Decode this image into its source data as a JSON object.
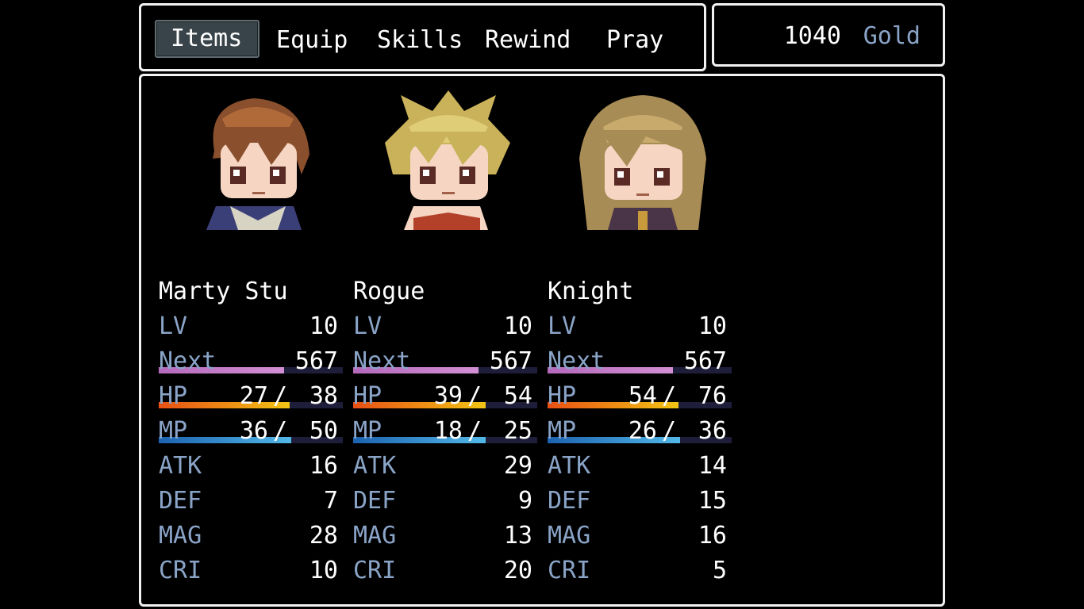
{
  "commands": [
    "Items",
    "Equip",
    "Skills",
    "Rewind",
    "Pray"
  ],
  "gold": {
    "value": "1040",
    "unit": "Gold"
  },
  "labels": {
    "lv": "LV",
    "next": "Next",
    "hp": "HP",
    "mp": "MP",
    "atk": "ATK",
    "def": "DEF",
    "mag": "MAG",
    "cri": "CRI",
    "slash": "/"
  },
  "colors": {
    "label": "#8aa4c8",
    "selected_bg": "#39444a",
    "window_border": "#f2f2f2"
  },
  "actors": [
    {
      "name": "Marty Stu",
      "portrait": "brown-haired-boy-portrait",
      "lv": "10",
      "next": "567",
      "next_fill": 0.68,
      "hp_cur": "27",
      "hp_max": "38",
      "hp_fill": 0.71,
      "mp_cur": "36",
      "mp_max": "50",
      "mp_fill": 0.72,
      "atk": "16",
      "def": "7",
      "mag": "28",
      "cri": "10"
    },
    {
      "name": "Rogue",
      "portrait": "blonde-spiky-girl-portrait",
      "lv": "10",
      "next": "567",
      "next_fill": 0.68,
      "hp_cur": "39",
      "hp_max": "54",
      "hp_fill": 0.72,
      "mp_cur": "18",
      "mp_max": "25",
      "mp_fill": 0.72,
      "atk": "29",
      "def": "9",
      "mag": "13",
      "cri": "20"
    },
    {
      "name": "Knight",
      "portrait": "long-blonde-hair-girl-portrait",
      "lv": "10",
      "next": "567",
      "next_fill": 0.68,
      "hp_cur": "54",
      "hp_max": "76",
      "hp_fill": 0.71,
      "mp_cur": "26",
      "mp_max": "36",
      "mp_fill": 0.72,
      "atk": "14",
      "def": "15",
      "mag": "16",
      "cri": "5"
    }
  ]
}
